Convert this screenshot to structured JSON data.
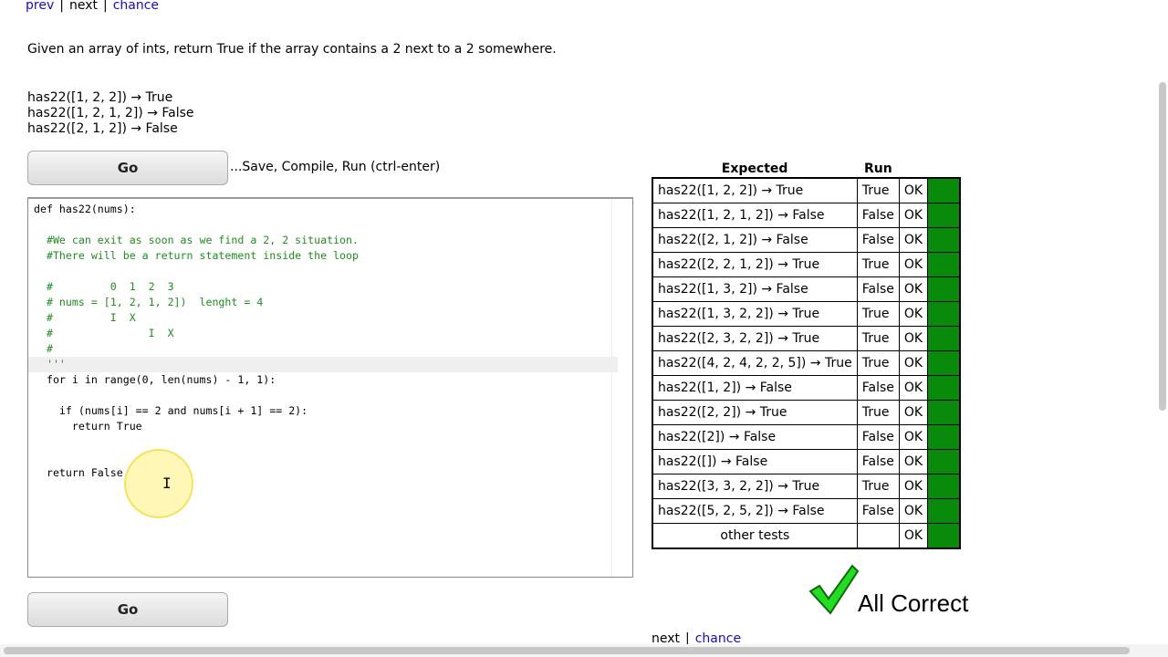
{
  "nav": {
    "prev": "prev",
    "next": "next",
    "chance": "chance",
    "sep": "|"
  },
  "problem": {
    "description": "Given an array of ints, return True if the array contains a 2 next to a 2 somewhere.",
    "examples": [
      "has22([1, 2, 2]) → True",
      "has22([1, 2, 1, 2]) → False",
      "has22([2, 1, 2]) → False"
    ]
  },
  "go_label": "Go",
  "go_hint": "...Save, Compile, Run (ctrl-enter)",
  "code_lines": [
    "def has22(nums):",
    "",
    "  #We can exit as soon as we find a 2, 2 situation.",
    "  #There will be a return statement inside the loop",
    "",
    "  #         0  1  2  3",
    "  # nums = [1, 2, 1, 2])  lenght = 4",
    "  #         I  X",
    "  #               I  X",
    "  #",
    "  '''",
    "  for i in range(0, len(nums) - 1, 1):",
    "",
    "    if (nums[i] == 2 and nums[i + 1] == 2):",
    "      return True",
    "",
    "",
    "  return False"
  ],
  "results": {
    "headers": {
      "expected": "Expected",
      "run": "Run"
    },
    "rows": [
      {
        "expected": "has22([1, 2, 2]) → True",
        "run": "True",
        "status": "OK"
      },
      {
        "expected": "has22([1, 2, 1, 2]) → False",
        "run": "False",
        "status": "OK"
      },
      {
        "expected": "has22([2, 1, 2]) → False",
        "run": "False",
        "status": "OK"
      },
      {
        "expected": "has22([2, 2, 1, 2]) → True",
        "run": "True",
        "status": "OK"
      },
      {
        "expected": "has22([1, 3, 2]) → False",
        "run": "False",
        "status": "OK"
      },
      {
        "expected": "has22([1, 3, 2, 2]) → True",
        "run": "True",
        "status": "OK"
      },
      {
        "expected": "has22([2, 3, 2, 2]) → True",
        "run": "True",
        "status": "OK"
      },
      {
        "expected": "has22([4, 2, 4, 2, 2, 5]) → True",
        "run": "True",
        "status": "OK"
      },
      {
        "expected": "has22([1, 2]) → False",
        "run": "False",
        "status": "OK"
      },
      {
        "expected": "has22([2, 2]) → True",
        "run": "True",
        "status": "OK"
      },
      {
        "expected": "has22([2]) → False",
        "run": "False",
        "status": "OK"
      },
      {
        "expected": "has22([]) → False",
        "run": "False",
        "status": "OK"
      },
      {
        "expected": "has22([3, 3, 2, 2]) → True",
        "run": "True",
        "status": "OK"
      },
      {
        "expected": "has22([5, 2, 5, 2]) → False",
        "run": "False",
        "status": "OK"
      },
      {
        "expected": "other tests",
        "run": "",
        "status": "OK"
      }
    ]
  },
  "all_correct": "All Correct",
  "colors": {
    "pass": "#0a8a0a",
    "check": "#22dd22",
    "link": "#1a0dab"
  }
}
